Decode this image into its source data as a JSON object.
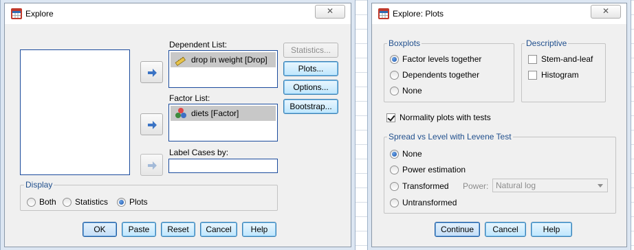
{
  "explore": {
    "title": "Explore",
    "close_glyph": "✕",
    "dependent_list_label": "Dependent List:",
    "dependent_item": "drop in weight [Drop]",
    "factor_list_label": "Factor List:",
    "factor_item": "diets [Factor]",
    "label_cases_label": "Label Cases by:",
    "buttons": {
      "statistics": "Statistics...",
      "plots": "Plots...",
      "options": "Options...",
      "bootstrap": "Bootstrap...",
      "ok": "OK",
      "paste": "Paste",
      "reset": "Reset",
      "cancel": "Cancel",
      "help": "Help"
    },
    "display": {
      "legend": "Display",
      "options": [
        "Both",
        "Statistics",
        "Plots"
      ],
      "selected": "Plots"
    }
  },
  "plots": {
    "title": "Explore: Plots",
    "close_glyph": "✕",
    "boxplots": {
      "legend": "Boxplots",
      "options": [
        "Factor levels together",
        "Dependents together",
        "None"
      ],
      "selected": "Factor levels together"
    },
    "descriptive": {
      "legend": "Descriptive",
      "stem_and_leaf": "Stem-and-leaf",
      "histogram": "Histogram",
      "stem_checked": false,
      "histogram_checked": false
    },
    "normality": {
      "label": "Normality plots with tests",
      "checked": true
    },
    "spread": {
      "legend": "Spread vs Level with Levene Test",
      "options": [
        "None",
        "Power estimation",
        "Transformed",
        "Untransformed"
      ],
      "selected": "None",
      "power_label": "Power:",
      "power_value": "Natural log"
    },
    "buttons": {
      "continue": "Continue",
      "cancel": "Cancel",
      "help": "Help"
    }
  },
  "colors": {
    "legend_text": "#1f4e8c",
    "listbox_border": "#1a4a9c",
    "button_blue": "#bee6fd"
  }
}
